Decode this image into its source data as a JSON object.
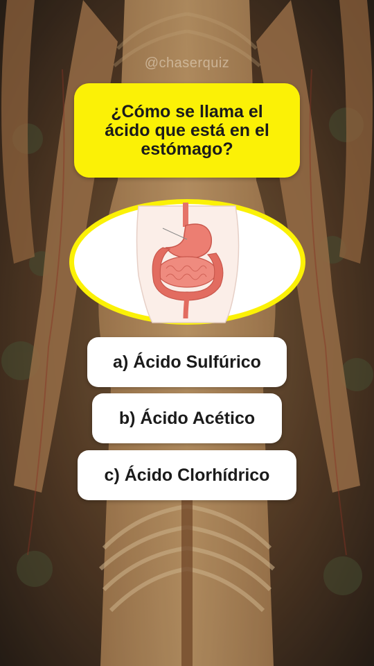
{
  "handle": "@chaserquiz",
  "question": "¿Cómo se llama el ácido que está en el estómago?",
  "image": {
    "icon": "stomach-digestive-illustration",
    "frame_color": "#fbf106"
  },
  "answers": [
    {
      "label": "a) Ácido Sulfúrico"
    },
    {
      "label": "b) Ácido Acético"
    },
    {
      "label": "c) Ácido Clorhídrico"
    }
  ],
  "colors": {
    "question_bg": "#fbf106",
    "answer_bg": "#ffffff",
    "text": "#1b1b1b",
    "background": "#3a2a1c"
  }
}
